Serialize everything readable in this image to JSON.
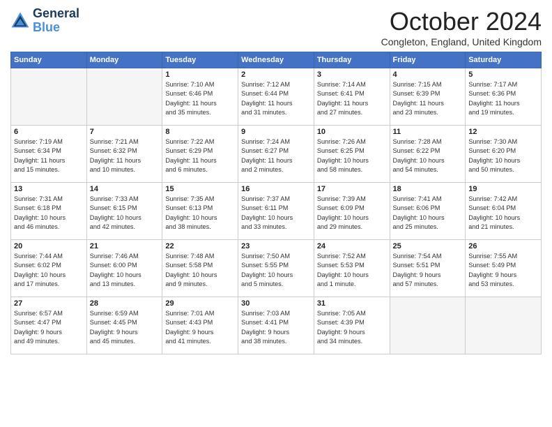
{
  "logo": {
    "line1": "General",
    "line2": "Blue"
  },
  "title": "October 2024",
  "location": "Congleton, England, United Kingdom",
  "days_of_week": [
    "Sunday",
    "Monday",
    "Tuesday",
    "Wednesday",
    "Thursday",
    "Friday",
    "Saturday"
  ],
  "weeks": [
    [
      {
        "num": "",
        "info": ""
      },
      {
        "num": "",
        "info": ""
      },
      {
        "num": "1",
        "info": "Sunrise: 7:10 AM\nSunset: 6:46 PM\nDaylight: 11 hours\nand 35 minutes."
      },
      {
        "num": "2",
        "info": "Sunrise: 7:12 AM\nSunset: 6:44 PM\nDaylight: 11 hours\nand 31 minutes."
      },
      {
        "num": "3",
        "info": "Sunrise: 7:14 AM\nSunset: 6:41 PM\nDaylight: 11 hours\nand 27 minutes."
      },
      {
        "num": "4",
        "info": "Sunrise: 7:15 AM\nSunset: 6:39 PM\nDaylight: 11 hours\nand 23 minutes."
      },
      {
        "num": "5",
        "info": "Sunrise: 7:17 AM\nSunset: 6:36 PM\nDaylight: 11 hours\nand 19 minutes."
      }
    ],
    [
      {
        "num": "6",
        "info": "Sunrise: 7:19 AM\nSunset: 6:34 PM\nDaylight: 11 hours\nand 15 minutes."
      },
      {
        "num": "7",
        "info": "Sunrise: 7:21 AM\nSunset: 6:32 PM\nDaylight: 11 hours\nand 10 minutes."
      },
      {
        "num": "8",
        "info": "Sunrise: 7:22 AM\nSunset: 6:29 PM\nDaylight: 11 hours\nand 6 minutes."
      },
      {
        "num": "9",
        "info": "Sunrise: 7:24 AM\nSunset: 6:27 PM\nDaylight: 11 hours\nand 2 minutes."
      },
      {
        "num": "10",
        "info": "Sunrise: 7:26 AM\nSunset: 6:25 PM\nDaylight: 10 hours\nand 58 minutes."
      },
      {
        "num": "11",
        "info": "Sunrise: 7:28 AM\nSunset: 6:22 PM\nDaylight: 10 hours\nand 54 minutes."
      },
      {
        "num": "12",
        "info": "Sunrise: 7:30 AM\nSunset: 6:20 PM\nDaylight: 10 hours\nand 50 minutes."
      }
    ],
    [
      {
        "num": "13",
        "info": "Sunrise: 7:31 AM\nSunset: 6:18 PM\nDaylight: 10 hours\nand 46 minutes."
      },
      {
        "num": "14",
        "info": "Sunrise: 7:33 AM\nSunset: 6:15 PM\nDaylight: 10 hours\nand 42 minutes."
      },
      {
        "num": "15",
        "info": "Sunrise: 7:35 AM\nSunset: 6:13 PM\nDaylight: 10 hours\nand 38 minutes."
      },
      {
        "num": "16",
        "info": "Sunrise: 7:37 AM\nSunset: 6:11 PM\nDaylight: 10 hours\nand 33 minutes."
      },
      {
        "num": "17",
        "info": "Sunrise: 7:39 AM\nSunset: 6:09 PM\nDaylight: 10 hours\nand 29 minutes."
      },
      {
        "num": "18",
        "info": "Sunrise: 7:41 AM\nSunset: 6:06 PM\nDaylight: 10 hours\nand 25 minutes."
      },
      {
        "num": "19",
        "info": "Sunrise: 7:42 AM\nSunset: 6:04 PM\nDaylight: 10 hours\nand 21 minutes."
      }
    ],
    [
      {
        "num": "20",
        "info": "Sunrise: 7:44 AM\nSunset: 6:02 PM\nDaylight: 10 hours\nand 17 minutes."
      },
      {
        "num": "21",
        "info": "Sunrise: 7:46 AM\nSunset: 6:00 PM\nDaylight: 10 hours\nand 13 minutes."
      },
      {
        "num": "22",
        "info": "Sunrise: 7:48 AM\nSunset: 5:58 PM\nDaylight: 10 hours\nand 9 minutes."
      },
      {
        "num": "23",
        "info": "Sunrise: 7:50 AM\nSunset: 5:55 PM\nDaylight: 10 hours\nand 5 minutes."
      },
      {
        "num": "24",
        "info": "Sunrise: 7:52 AM\nSunset: 5:53 PM\nDaylight: 10 hours\nand 1 minute."
      },
      {
        "num": "25",
        "info": "Sunrise: 7:54 AM\nSunset: 5:51 PM\nDaylight: 9 hours\nand 57 minutes."
      },
      {
        "num": "26",
        "info": "Sunrise: 7:55 AM\nSunset: 5:49 PM\nDaylight: 9 hours\nand 53 minutes."
      }
    ],
    [
      {
        "num": "27",
        "info": "Sunrise: 6:57 AM\nSunset: 4:47 PM\nDaylight: 9 hours\nand 49 minutes."
      },
      {
        "num": "28",
        "info": "Sunrise: 6:59 AM\nSunset: 4:45 PM\nDaylight: 9 hours\nand 45 minutes."
      },
      {
        "num": "29",
        "info": "Sunrise: 7:01 AM\nSunset: 4:43 PM\nDaylight: 9 hours\nand 41 minutes."
      },
      {
        "num": "30",
        "info": "Sunrise: 7:03 AM\nSunset: 4:41 PM\nDaylight: 9 hours\nand 38 minutes."
      },
      {
        "num": "31",
        "info": "Sunrise: 7:05 AM\nSunset: 4:39 PM\nDaylight: 9 hours\nand 34 minutes."
      },
      {
        "num": "",
        "info": ""
      },
      {
        "num": "",
        "info": ""
      }
    ]
  ]
}
